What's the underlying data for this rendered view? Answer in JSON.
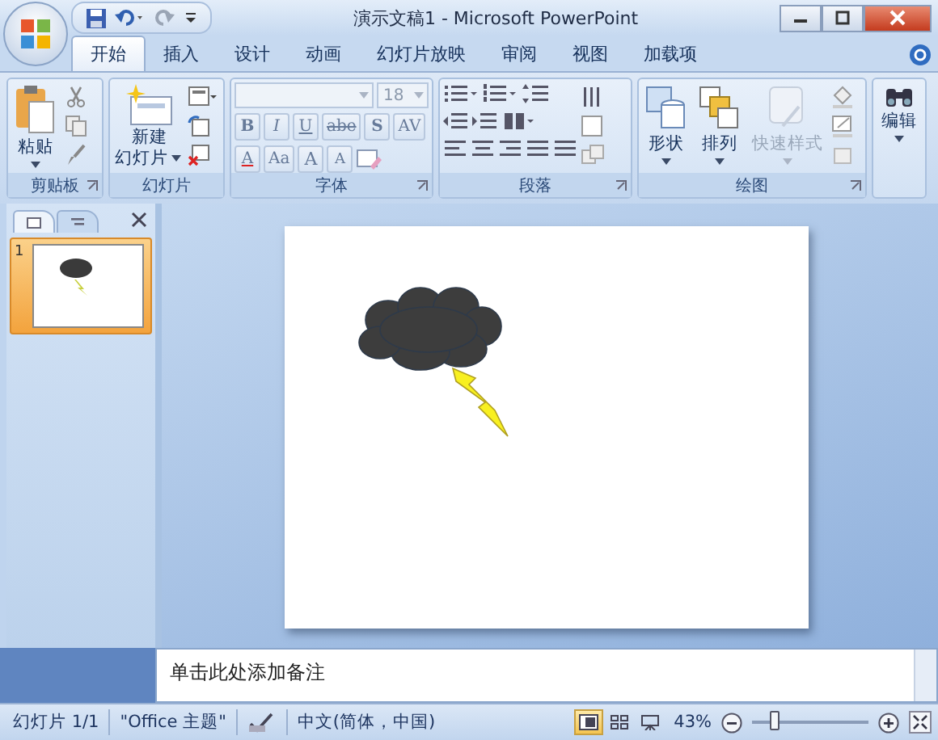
{
  "window": {
    "title": "演示文稿1 - Microsoft PowerPoint"
  },
  "tabs": [
    {
      "label": "开始",
      "selected": true
    },
    {
      "label": "插入",
      "selected": false
    },
    {
      "label": "设计",
      "selected": false
    },
    {
      "label": "动画",
      "selected": false
    },
    {
      "label": "幻灯片放映",
      "selected": false
    },
    {
      "label": "审阅",
      "selected": false
    },
    {
      "label": "视图",
      "selected": false
    },
    {
      "label": "加载项",
      "selected": false
    }
  ],
  "ribbon": {
    "groups": [
      {
        "kind": "clipboard",
        "label": "剪贴板",
        "button": "粘贴"
      },
      {
        "kind": "slides",
        "label": "幻灯片",
        "button": [
          "新建",
          "幻灯片"
        ]
      },
      {
        "kind": "font",
        "label": "字体",
        "font_size": "18",
        "format_buttons": [
          "B",
          "I",
          "U",
          "abe",
          "S",
          "AV"
        ],
        "size_buttons": [
          "A",
          "Aa",
          "A",
          "A"
        ]
      },
      {
        "kind": "paragraph",
        "label": "段落"
      },
      {
        "kind": "drawing",
        "label": "绘图",
        "buttons": [
          {
            "label": "形状",
            "disabled": false
          },
          {
            "label": "排列",
            "disabled": false
          },
          {
            "label": "快速样式",
            "disabled": true
          }
        ]
      },
      {
        "kind": "editing",
        "button": "编辑"
      }
    ]
  },
  "slide_panel": {
    "thumbnails": [
      {
        "number": "1",
        "selected": true
      }
    ]
  },
  "notes": {
    "text": "单击此处添加备注"
  },
  "status_bar": {
    "slide": "幻灯片 1/1",
    "theme": "\"Office 主题\"",
    "language": "中文(简体，中国)",
    "views": [
      {
        "kind": "normal",
        "selected": true
      },
      {
        "kind": "sorter",
        "selected": false
      },
      {
        "kind": "show",
        "selected": false
      }
    ],
    "zoom": "43%",
    "zoom_slider": {
      "level": 0.2
    }
  }
}
